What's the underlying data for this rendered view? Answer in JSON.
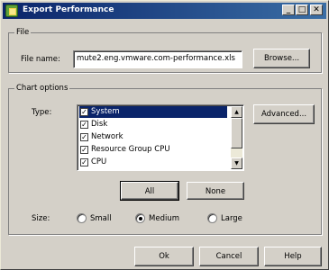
{
  "window": {
    "title": "Export Performance",
    "minimize_glyph": "_",
    "maximize_glyph": "□",
    "close_glyph": "✕"
  },
  "file_group": {
    "legend": "File",
    "file_name_label": "File name:",
    "file_name_value": "mute2.eng.vmware.com-performance.xls",
    "browse_label": "Browse..."
  },
  "chart_group": {
    "legend": "Chart options",
    "type_label": "Type:",
    "advanced_label": "Advanced...",
    "types": [
      {
        "label": "System",
        "checked": true,
        "selected": true
      },
      {
        "label": "Disk",
        "checked": true,
        "selected": false
      },
      {
        "label": "Network",
        "checked": true,
        "selected": false
      },
      {
        "label": "Resource Group CPU",
        "checked": true,
        "selected": false
      },
      {
        "label": "CPU",
        "checked": true,
        "selected": false
      }
    ],
    "check_glyph": "✓",
    "scroll_up_glyph": "▲",
    "scroll_down_glyph": "▼",
    "all_label": "All",
    "none_label": "None",
    "size_label": "Size:",
    "sizes": [
      {
        "label": "Small",
        "selected": false
      },
      {
        "label": "Medium",
        "selected": true
      },
      {
        "label": "Large",
        "selected": false
      }
    ]
  },
  "footer": {
    "ok_label": "Ok",
    "cancel_label": "Cancel",
    "help_label": "Help"
  },
  "colors": {
    "dialog_bg": "#d4d0c8",
    "title_gradient_start": "#0a246a",
    "title_gradient_end": "#3a6ea5",
    "selection": "#0a246a"
  }
}
